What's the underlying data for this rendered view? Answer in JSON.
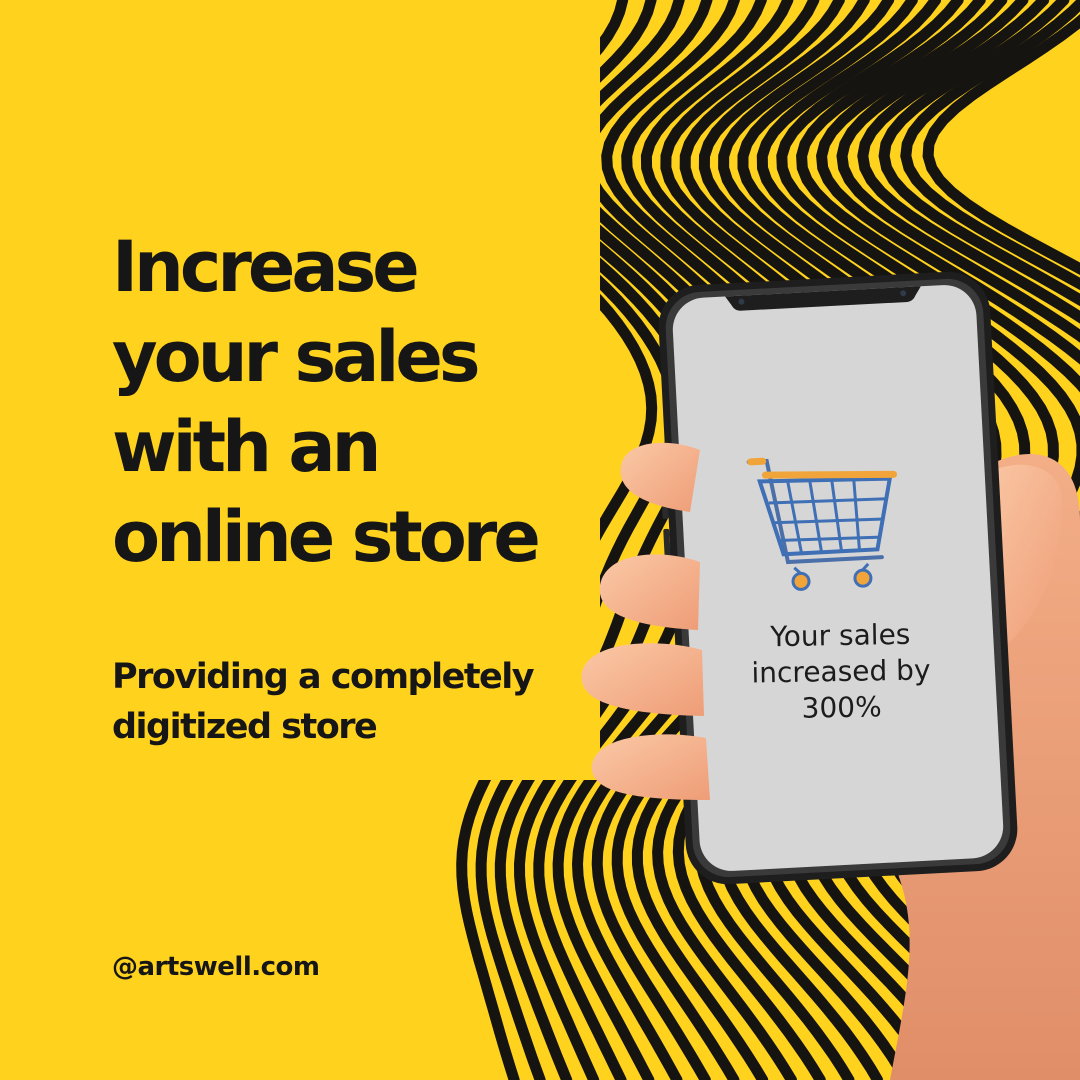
{
  "headline": {
    "line1": "Increase",
    "line2": "your sales",
    "line3": "with an",
    "line4": "online store"
  },
  "subheadline": {
    "line1": "Providing a completely",
    "line2": "digitized store"
  },
  "handle": "@artswell.com",
  "phone": {
    "message_line1": "Your sales",
    "message_line2": "increased by",
    "message_line3": "300%",
    "icon": "shopping-cart-icon"
  },
  "colors": {
    "background": "#FFD21E",
    "text": "#161616",
    "stripes": "#161410",
    "screen": "#D6D6D6",
    "cart_basket": "#3F6FB5",
    "cart_handle": "#F0A43A"
  }
}
